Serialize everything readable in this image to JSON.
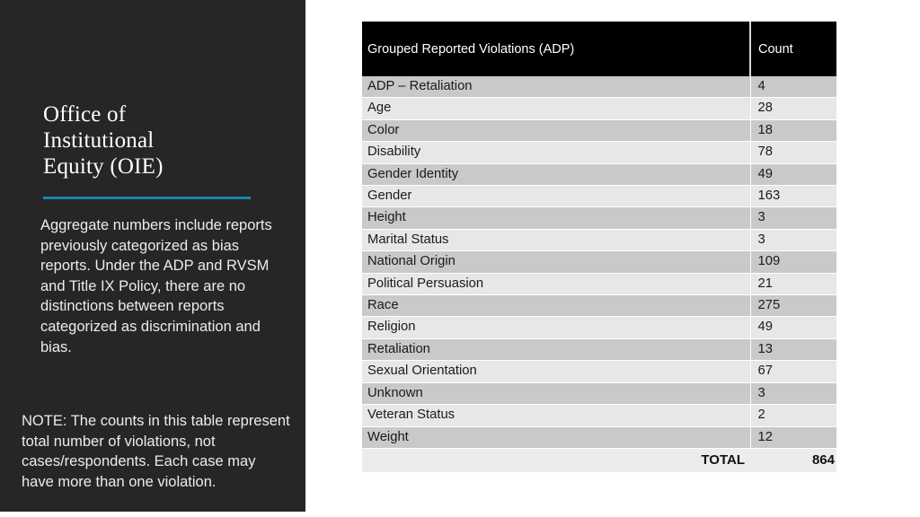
{
  "slide": {
    "background_color": "#ffffff",
    "panel_color": "#262626",
    "accent_color": "#1b84b0",
    "title": "Office of\nInstitutional\nEquity (OIE)",
    "body_text": "Aggregate numbers include reports previously categorized as bias reports. Under the ADP and RVSM and Title IX Policy, there are no distinctions between reports categorized as discrimination and bias.",
    "note_text": "NOTE: The counts in this table represent total number of violations, not cases/respondents. Each case may have more than one violation."
  },
  "table": {
    "header_background": "#000000",
    "header_text_color": "#ffffff",
    "row_band_dark": "#c9c9c9",
    "row_band_light": "#e7e7e7",
    "columns": [
      "Grouped Reported Violations (ADP)",
      "Count"
    ],
    "rows": [
      {
        "label": "ADP – Retaliation",
        "count": "4"
      },
      {
        "label": "Age",
        "count": "28"
      },
      {
        "label": "Color",
        "count": "18"
      },
      {
        "label": "Disability",
        "count": "78"
      },
      {
        "label": "Gender Identity",
        "count": "49"
      },
      {
        "label": "Gender",
        "count": "163"
      },
      {
        "label": "Height",
        "count": "3"
      },
      {
        "label": "Marital Status",
        "count": "3"
      },
      {
        "label": "National Origin",
        "count": "109"
      },
      {
        "label": "Political Persuasion",
        "count": "21"
      },
      {
        "label": "Race",
        "count": "275"
      },
      {
        "label": "Religion",
        "count": "49"
      },
      {
        "label": "Retaliation",
        "count": "13"
      },
      {
        "label": "Sexual Orientation",
        "count": "67"
      },
      {
        "label": "Unknown",
        "count": "3"
      },
      {
        "label": "Veteran Status",
        "count": "2"
      },
      {
        "label": "Weight",
        "count": "12"
      }
    ],
    "total_label": "TOTAL",
    "total_count": "864"
  },
  "chart_data": {
    "type": "table",
    "title": "Grouped Reported Violations (ADP)",
    "categories": [
      "ADP – Retaliation",
      "Age",
      "Color",
      "Disability",
      "Gender Identity",
      "Gender",
      "Height",
      "Marital Status",
      "National Origin",
      "Political Persuasion",
      "Race",
      "Religion",
      "Retaliation",
      "Sexual Orientation",
      "Unknown",
      "Veteran Status",
      "Weight"
    ],
    "values": [
      4,
      28,
      18,
      78,
      49,
      163,
      3,
      3,
      109,
      21,
      275,
      49,
      13,
      67,
      3,
      2,
      12
    ],
    "ylabel": "Count",
    "xlabel": "",
    "total": 864
  }
}
